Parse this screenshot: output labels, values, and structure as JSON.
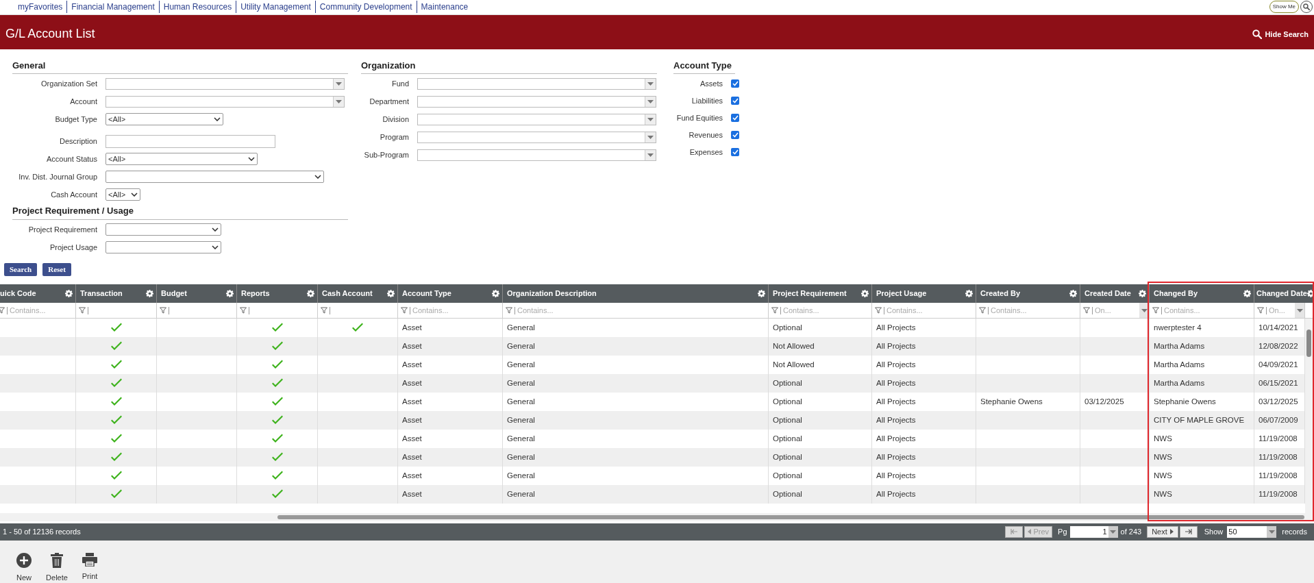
{
  "top_nav": {
    "links": [
      "myFavorites",
      "Financial Management",
      "Human Resources",
      "Utility Management",
      "Community Development",
      "Maintenance"
    ],
    "show_me": "Show Me"
  },
  "header": {
    "title": "G/L Account List",
    "hide_search": "Hide Search"
  },
  "form": {
    "columns": [
      {
        "sections": [
          {
            "title": "General",
            "fields": [
              {
                "label": "Organization Set",
                "kind": "combo"
              },
              {
                "label": "Account",
                "kind": "combo"
              },
              {
                "label": "Budget Type",
                "kind": "select",
                "value": "<All>"
              },
              {
                "label": "Description",
                "kind": "text"
              },
              {
                "label": "Account Status",
                "kind": "select",
                "value": "<All>"
              },
              {
                "label": "Inv. Dist. Journal Group",
                "kind": "select"
              },
              {
                "label": "Cash Account",
                "kind": "select",
                "value": "<All>"
              }
            ]
          },
          {
            "title": "Project Requirement / Usage",
            "fields": [
              {
                "label": "Project Requirement",
                "kind": "select"
              },
              {
                "label": "Project Usage",
                "kind": "select"
              }
            ]
          }
        ]
      },
      {
        "sections": [
          {
            "title": "Organization",
            "fields": [
              {
                "label": "Fund",
                "kind": "combo"
              },
              {
                "label": "Department",
                "kind": "combo"
              },
              {
                "label": "Division",
                "kind": "combo"
              },
              {
                "label": "Program",
                "kind": "combo"
              },
              {
                "label": "Sub-Program",
                "kind": "combo"
              }
            ]
          }
        ]
      },
      {
        "sections": [
          {
            "title": "Account Type",
            "fields": [
              {
                "label": "Assets",
                "kind": "checkbox",
                "checked": true
              },
              {
                "label": "Liabilities",
                "kind": "checkbox",
                "checked": true
              },
              {
                "label": "Fund Equities",
                "kind": "checkbox",
                "checked": true
              },
              {
                "label": "Revenues",
                "kind": "checkbox",
                "checked": true
              },
              {
                "label": "Expenses",
                "kind": "checkbox",
                "checked": true
              }
            ]
          }
        ]
      }
    ],
    "buttons": [
      "Search",
      "Reset"
    ]
  },
  "table": {
    "columns": [
      {
        "label": "uick Code",
        "kind": "text",
        "filter": "Contains..."
      },
      {
        "label": "Transaction",
        "kind": "check"
      },
      {
        "label": "Budget",
        "kind": "check"
      },
      {
        "label": "Reports",
        "kind": "check"
      },
      {
        "label": "Cash Account",
        "kind": "check"
      },
      {
        "label": "Account Type",
        "kind": "text",
        "filter": "Contains..."
      },
      {
        "label": "Organization Description",
        "kind": "text",
        "filter": "Contains..."
      },
      {
        "label": "Project Requirement",
        "kind": "text",
        "filter": "Contains..."
      },
      {
        "label": "Project Usage",
        "kind": "text",
        "filter": "Contains..."
      },
      {
        "label": "Created By",
        "kind": "text",
        "filter": "Contains..."
      },
      {
        "label": "Created Date",
        "kind": "date",
        "filter": "On..."
      },
      {
        "label": "Changed By",
        "kind": "text",
        "filter": "Contains...",
        "highlighted": true
      },
      {
        "label": "Changed Date",
        "kind": "date",
        "filter": "On...",
        "highlighted": true
      }
    ],
    "rows": [
      {
        "cells": [
          null,
          true,
          false,
          true,
          true,
          "Asset",
          "General",
          "Optional",
          "All Projects",
          null,
          null,
          "nwerptester 4",
          "10/14/2021"
        ]
      },
      {
        "cells": [
          null,
          true,
          false,
          true,
          false,
          "Asset",
          "General",
          "Not Allowed",
          "All Projects",
          null,
          null,
          "Martha Adams",
          "12/08/2022"
        ]
      },
      {
        "cells": [
          null,
          true,
          false,
          true,
          false,
          "Asset",
          "General",
          "Not Allowed",
          "All Projects",
          null,
          null,
          "Martha Adams",
          "04/09/2021"
        ]
      },
      {
        "cells": [
          null,
          true,
          false,
          true,
          false,
          "Asset",
          "General",
          "Optional",
          "All Projects",
          null,
          null,
          "Martha Adams",
          "06/15/2021"
        ]
      },
      {
        "cells": [
          null,
          true,
          false,
          true,
          false,
          "Asset",
          "General",
          "Optional",
          "All Projects",
          "Stephanie Owens",
          "03/12/2025",
          "Stephanie Owens",
          "03/12/2025"
        ]
      },
      {
        "cells": [
          null,
          true,
          false,
          true,
          false,
          "Asset",
          "General",
          "Optional",
          "All Projects",
          null,
          null,
          "CITY OF MAPLE GROVE",
          "06/07/2009"
        ]
      },
      {
        "cells": [
          null,
          true,
          false,
          true,
          false,
          "Asset",
          "General",
          "Optional",
          "All Projects",
          null,
          null,
          "NWS",
          "11/19/2008"
        ]
      },
      {
        "cells": [
          null,
          true,
          false,
          true,
          false,
          "Asset",
          "General",
          "Optional",
          "All Projects",
          null,
          null,
          "NWS",
          "11/19/2008"
        ]
      },
      {
        "cells": [
          null,
          true,
          false,
          true,
          false,
          "Asset",
          "General",
          "Optional",
          "All Projects",
          null,
          null,
          "NWS",
          "11/19/2008"
        ]
      },
      {
        "cells": [
          null,
          true,
          false,
          true,
          false,
          "Asset",
          "General",
          "Optional",
          "All Projects",
          null,
          null,
          "NWS",
          "11/19/2008"
        ]
      }
    ]
  },
  "pager": {
    "summary": "1 - 50 of 12136 records",
    "prev": "Prev",
    "pg_label": "Pg",
    "page": "1",
    "of_pages": "of 243",
    "next": "Next",
    "show_label": "Show",
    "show_value": "50",
    "records_label": "records"
  },
  "toolbar": [
    {
      "kind": "new",
      "label": "New"
    },
    {
      "kind": "delete",
      "label": "Delete"
    },
    {
      "kind": "print",
      "label": "Print"
    }
  ]
}
